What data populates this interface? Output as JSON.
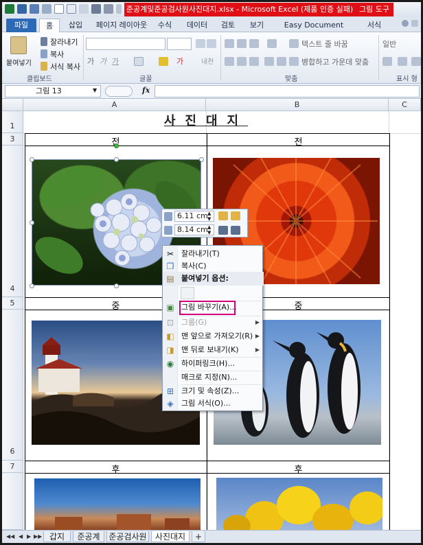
{
  "window": {
    "title": "준공계및준공검사원사진대지.xlsx  -  Microsoft Excel (제품 인증 실패)",
    "context_tab": "그림 도구"
  },
  "ribbon_tabs": [
    "파일",
    "홈",
    "삽입",
    "페이지 레이아웃",
    "수식",
    "데이터",
    "검토",
    "보기",
    "Easy Document Creator",
    "서식"
  ],
  "clipboard": {
    "paste": "붙여넣기",
    "cut": "잘라내기",
    "copy": "복사",
    "format_painter": "서식 복사",
    "group": "클립보드"
  },
  "font": {
    "group": "글꼴",
    "bold": "가",
    "italic": "가",
    "underline": "가",
    "color": "가",
    "ga": "가",
    "phonetic": "내천"
  },
  "alignment": {
    "wrap": "텍스트 줄 바꿈",
    "merge": "병합하고 가운데 맞춤",
    "group": "맞춤"
  },
  "number": {
    "format": "일반",
    "group": "표시 형"
  },
  "formula_bar": {
    "name_box": "그림 13",
    "fx": "fx",
    "formula": ""
  },
  "columns": [
    "A",
    "B",
    "C"
  ],
  "rows": [
    "1",
    "3",
    "4",
    "5",
    "6",
    "7"
  ],
  "sheet": {
    "title": "사진대지",
    "labels": [
      "전",
      "전",
      "중",
      "중",
      "후",
      "후"
    ]
  },
  "mini_toolbar": {
    "height": "6.11 cm",
    "width": "8.14 cm"
  },
  "context_menu": {
    "items": [
      {
        "label": "잘라내기(T)",
        "icon": "scissors-icon",
        "disabled": false
      },
      {
        "label": "복사(C)",
        "icon": "copy-icon",
        "disabled": false
      },
      {
        "label": "붙여넣기 옵션:",
        "icon": "paste-icon",
        "disabled": false,
        "header": true
      },
      {
        "label": "그림 바꾸기(A)...",
        "icon": "change-picture-icon",
        "disabled": false,
        "highlighted": true
      },
      {
        "label": "그룹(G)",
        "icon": "group-icon",
        "disabled": true,
        "submenu": true
      },
      {
        "label": "맨 앞으로 가져오기(R)",
        "icon": "bring-front-icon",
        "disabled": false,
        "submenu": true
      },
      {
        "label": "맨 뒤로 보내기(K)",
        "icon": "send-back-icon",
        "disabled": false,
        "submenu": true
      },
      {
        "label": "하이퍼링크(H)...",
        "icon": "hyperlink-icon",
        "disabled": false
      },
      {
        "label": "매크로 지정(N)...",
        "icon": "",
        "disabled": false
      },
      {
        "label": "크기 및 속성(Z)...",
        "icon": "size-icon",
        "disabled": false
      },
      {
        "label": "그림 서식(O)...",
        "icon": "format-picture-icon",
        "disabled": false
      }
    ],
    "highlight_color": "#d3007d"
  },
  "sheet_tabs": [
    "갑지",
    "준공계",
    "준공검사원",
    "사진대지"
  ],
  "active_sheet": "사진대지"
}
